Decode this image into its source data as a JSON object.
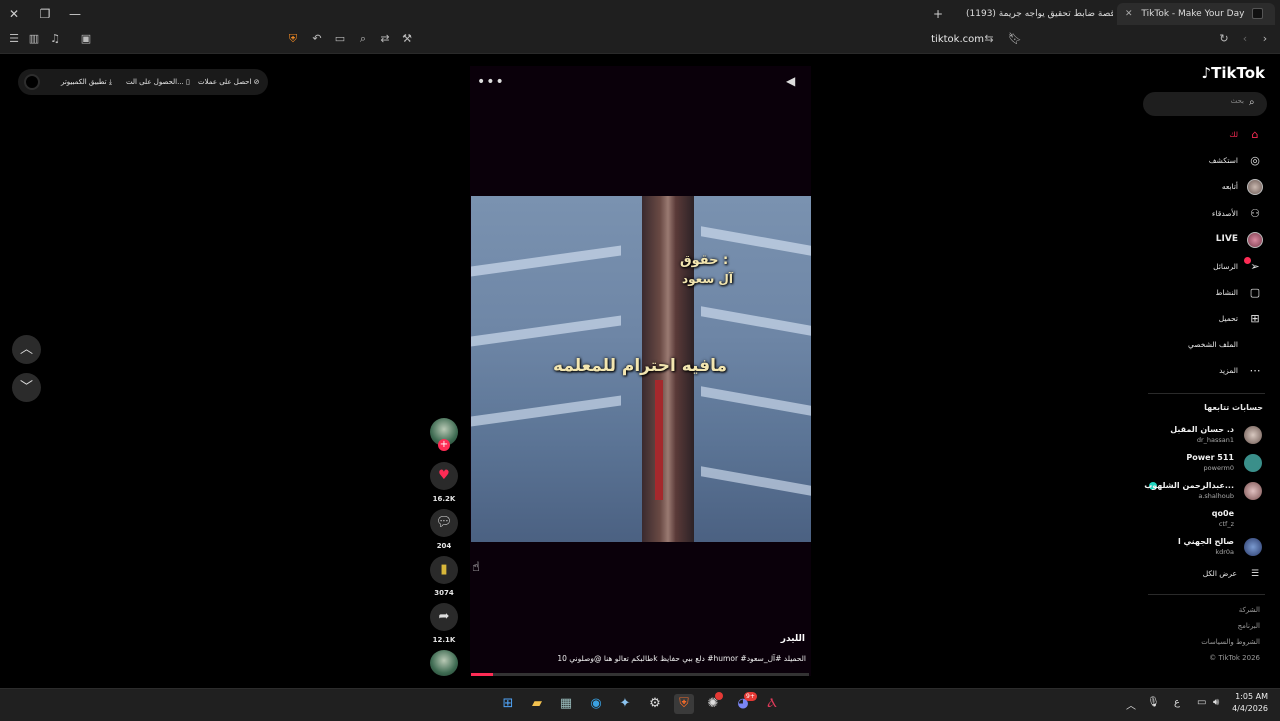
{
  "window": {
    "close_glyph": "✕",
    "restore_glyph": "❐",
    "minimize_glyph": "—"
  },
  "tabs": {
    "active_title": "TikTok - Make Your Day",
    "inactive_title": "(1193) قصة ضابط تحقيق يواجه جريمة",
    "new_tab_glyph": "+"
  },
  "toolbar": {
    "url": "tiktok.com"
  },
  "promo_pill": {
    "coins": "احصل على عملات",
    "get_app": "الحصول على الت...",
    "desktop_app": "تطبيق الكمبيوتر"
  },
  "video": {
    "overlay_main": "مافيه احترام للمعلمه",
    "overlay_top1": "حقوق :",
    "overlay_top2": "آل سعود",
    "author": "الليدر",
    "description": "طالبكم تعالو هنا @وصلوني 10k دلع ببي حفايظ #humor #الحميلد #آل_سعود",
    "progress_fraction": 0.065
  },
  "actions": {
    "likes": "16.2K",
    "comments": "204",
    "saves": "3074",
    "shares": "12.1K"
  },
  "sidebar": {
    "logo": "TikTok",
    "search_placeholder": "بحث",
    "nav": [
      {
        "label": "لك",
        "icon": "home-icon",
        "active": true
      },
      {
        "label": "استكشف",
        "icon": "compass-icon"
      },
      {
        "label": "أتابعه",
        "icon": "following-avatar-icon"
      },
      {
        "label": "الأصدقاء",
        "icon": "friends-icon"
      },
      {
        "label": "LIVE",
        "icon": "live-icon"
      },
      {
        "label": "الرسائل",
        "icon": "messages-icon"
      },
      {
        "label": "النشاط",
        "icon": "activity-icon"
      },
      {
        "label": "تحميل",
        "icon": "upload-icon"
      },
      {
        "label": "الملف الشخصي",
        "icon": "profile-icon"
      },
      {
        "label": "المزيد",
        "icon": "more-icon"
      }
    ],
    "following_title": "حسابات تتابعها",
    "accounts": [
      {
        "name": "د. حسان المقبل",
        "user": "dr_hassan1"
      },
      {
        "name": "Power 511",
        "user": "powerm0"
      },
      {
        "name": "عبدالرحمن الشلهوب...",
        "user": "a.shalhoub"
      },
      {
        "name": "qo0e",
        "user": "ctf_z"
      },
      {
        "name": "صالح الجهني ا",
        "user": "kdr0a"
      }
    ],
    "see_all": "عرض الكل",
    "footer": {
      "company": "الشركة",
      "program": "البرنامج",
      "terms": "الشروط والسياسات",
      "copyright": "© TikTok 2026"
    }
  },
  "taskbar": {
    "time": "1:05 AM",
    "date": "4/4/2026",
    "lang": "ع",
    "discord_badge": "9+"
  },
  "colors": {
    "accent": "#fe2c55",
    "bookmark": "#d8b73a",
    "chrome_bg": "#1f1f1f"
  }
}
